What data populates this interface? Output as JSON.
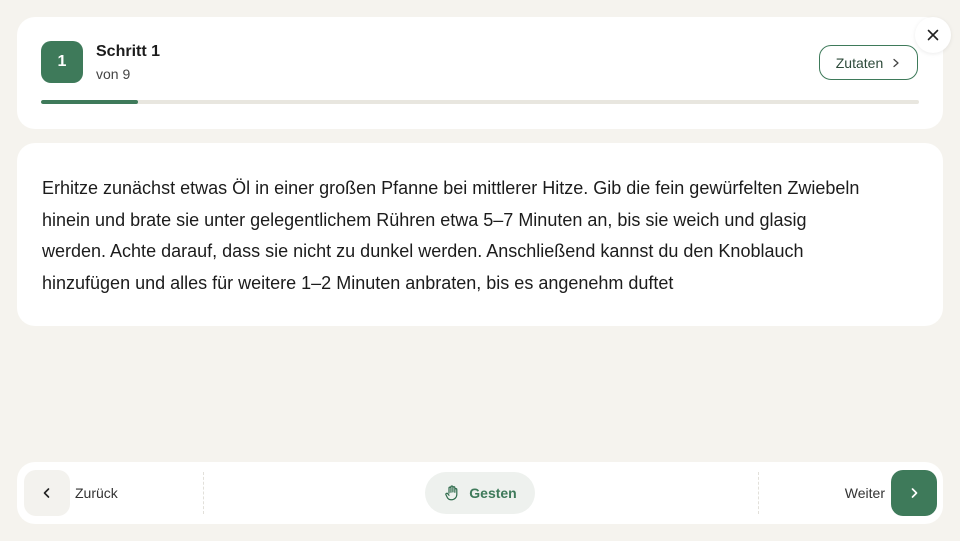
{
  "header": {
    "step_number": "1",
    "step_title": "Schritt 1",
    "step_sub": "von 9",
    "ingredients_label": "Zutaten",
    "progress_fraction": 0.111
  },
  "instruction": {
    "text": "Erhitze zunächst etwas Öl in einer großen Pfanne bei mittlerer Hitze. Gib die fein gewürfelten Zwie­beln hinein und brate sie unter gelegentlichem Rühren etwa 5–7 Minuten an, bis sie weich und gla­sig werden. Achte darauf, dass sie nicht zu dunkel werden. Anschließend kannst du den Knoblauch hinzufügen und alles für weitere 1–2 Minuten anbraten, bis es angenehm duftet"
  },
  "nav": {
    "back_label": "Zurück",
    "gesture_label": "Gesten",
    "next_label": "Weiter"
  },
  "icons": {
    "close": "close-icon",
    "back": "chevron-left-icon",
    "next": "chevron-right-icon",
    "ingredients": "chevron-right-icon",
    "gesture": "hand-icon"
  },
  "colors": {
    "accent": "#3e7a5a",
    "background": "#f5f3ee",
    "card": "#ffffff"
  }
}
